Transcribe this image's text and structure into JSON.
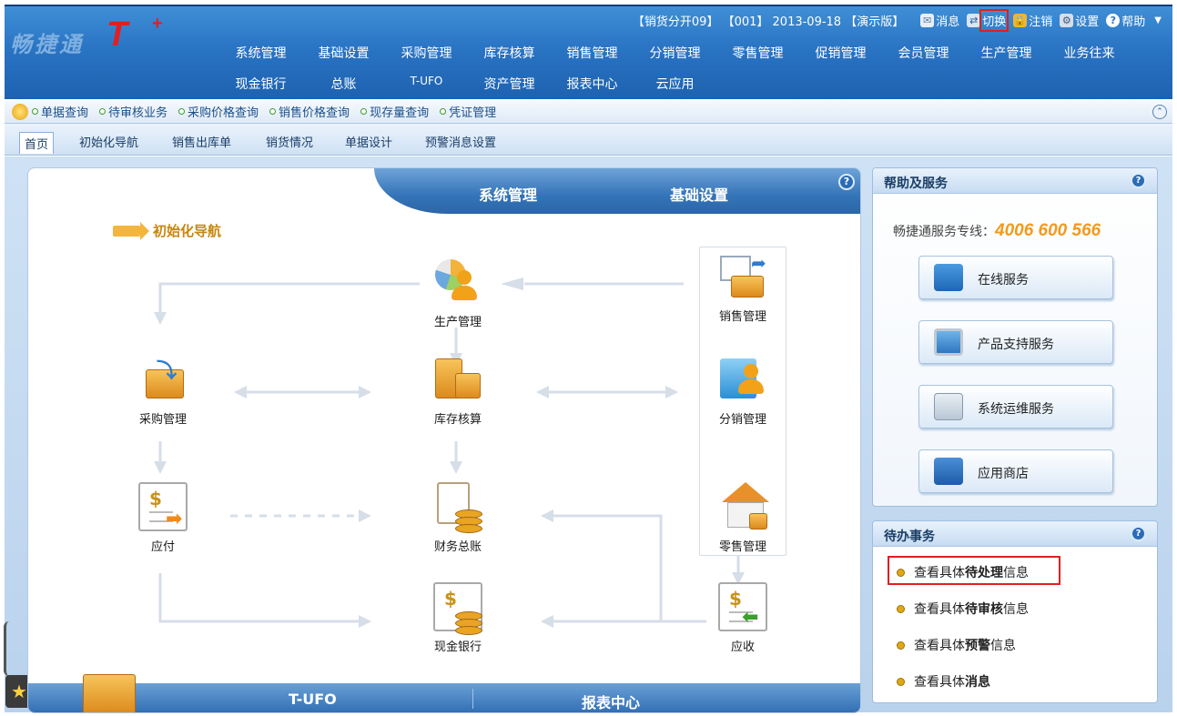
{
  "app": {
    "logo_text": "畅捷通",
    "logo_t": "T",
    "logo_plus": "+"
  },
  "topbar": {
    "info": "【销货分开09】 【001】 2013-09-18 【演示版】",
    "items": [
      {
        "label": "消息",
        "icon": "mail-icon"
      },
      {
        "label": "切换",
        "icon": "switch-icon",
        "highlighted": true
      },
      {
        "label": "注销",
        "icon": "lock-icon"
      },
      {
        "label": "设置",
        "icon": "settings-icon"
      },
      {
        "label": "帮助",
        "icon": "help-icon"
      }
    ],
    "dropdown_icon": "caret-down-icon"
  },
  "menu": {
    "row1": [
      "系统管理",
      "基础设置",
      "采购管理",
      "库存核算",
      "销售管理",
      "分销管理",
      "零售管理",
      "促销管理",
      "会员管理",
      "生产管理",
      "业务往来"
    ],
    "row2": [
      "现金银行",
      "总账",
      "T-UFO",
      "资产管理",
      "报表中心",
      "云应用"
    ]
  },
  "quickbar": {
    "items": [
      "单据查询",
      "待审核业务",
      "采购价格查询",
      "销售价格查询",
      "现存量查询",
      "凭证管理"
    ]
  },
  "tabs": [
    "首页",
    "初始化导航",
    "销售出库单",
    "销货情况",
    "单据设计",
    "预警消息设置"
  ],
  "flow": {
    "band_left": "系统管理",
    "band_right": "基础设置",
    "nav_title": "初始化导航",
    "nodes": {
      "production": "生产管理",
      "sales": "销售管理",
      "purchase": "采购管理",
      "inventory": "库存核算",
      "distribution": "分销管理",
      "payable": "应付",
      "ledger": "财务总账",
      "retail": "零售管理",
      "cash": "现金银行",
      "receivable": "应收"
    },
    "bottom_left": "T-UFO",
    "bottom_right": "报表中心"
  },
  "help_panel": {
    "title": "帮助及服务",
    "hotline_label": "畅捷通服务专线：",
    "hotline_number": "4006 600 566",
    "services": [
      {
        "label": "在线服务",
        "icon": "online-service-icon"
      },
      {
        "label": "产品支持服务",
        "icon": "monitor-icon"
      },
      {
        "label": "系统运维服务",
        "icon": "maintenance-icon"
      },
      {
        "label": "应用商店",
        "icon": "store-icon"
      }
    ]
  },
  "todo_panel": {
    "title": "待办事务",
    "items": [
      {
        "prefix": "查看具体",
        "bold": "待处理",
        "suffix": "信息"
      },
      {
        "prefix": "查看具体",
        "bold": "待审核",
        "suffix": "信息"
      },
      {
        "prefix": "查看具体",
        "bold": "预警",
        "suffix": "信息"
      },
      {
        "prefix": "查看具体",
        "bold": "消息",
        "suffix": ""
      }
    ]
  },
  "colors": {
    "accent": "#2a74c4",
    "highlight": "#e11f1f",
    "hotline": "#f39a1a"
  }
}
